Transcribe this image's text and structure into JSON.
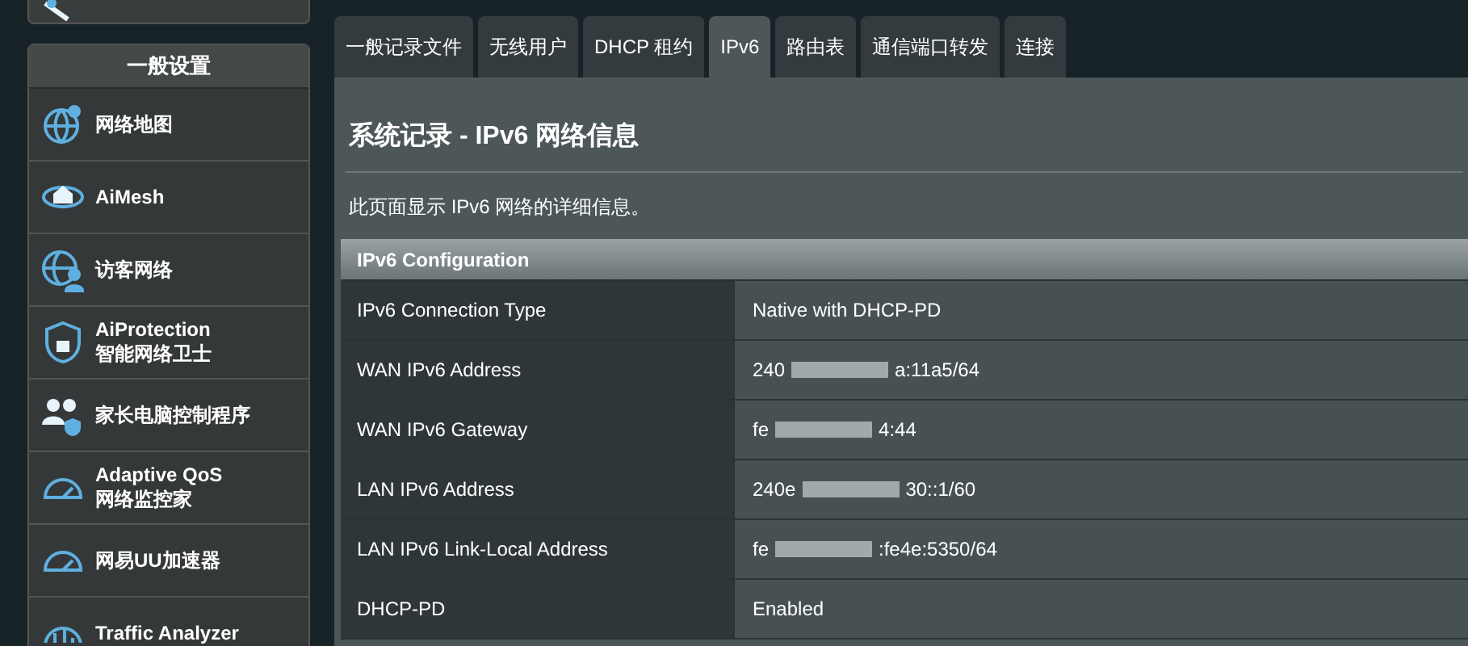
{
  "sidebar": {
    "section_title": "一般设置",
    "items": [
      {
        "title": "网络地图",
        "selected": false
      },
      {
        "title": "AiMesh",
        "selected": false
      },
      {
        "title": "访客网络",
        "selected": false
      },
      {
        "title": "AiProtection",
        "subtitle": "智能网络卫士",
        "selected": false
      },
      {
        "title": "家长电脑控制程序",
        "selected": false
      },
      {
        "title": "Adaptive QoS",
        "subtitle": "网络监控家",
        "selected": false
      },
      {
        "title": "网易UU加速器",
        "selected": false
      },
      {
        "title": "Traffic Analyzer",
        "selected": false
      }
    ]
  },
  "tabs": [
    {
      "label": "一般记录文件",
      "selected": false
    },
    {
      "label": "无线用户",
      "selected": false
    },
    {
      "label": "DHCP 租约",
      "selected": false
    },
    {
      "label": "IPv6",
      "selected": true
    },
    {
      "label": "路由表",
      "selected": false
    },
    {
      "label": "通信端口转发",
      "selected": false
    },
    {
      "label": "连接",
      "selected": false
    }
  ],
  "page": {
    "title": "系统记录 - IPv6 网络信息",
    "description": "此页面显示 IPv6 网络的详细信息。"
  },
  "table": {
    "header": "IPv6 Configuration",
    "rows": [
      {
        "label": "IPv6 Connection Type",
        "value_start": "Native with DHCP-PD"
      },
      {
        "label": "WAN IPv6 Address",
        "value_start": "240",
        "value_end": "a:11a5/64"
      },
      {
        "label": "WAN IPv6 Gateway",
        "value_start": "fe",
        "value_end": "4:44"
      },
      {
        "label": "LAN IPv6 Address",
        "value_start": "240e",
        "value_end": "30::1/60"
      },
      {
        "label": "LAN IPv6 Link-Local Address",
        "value_start": "fe",
        "value_end": ":fe4e:5350/64"
      },
      {
        "label": "DHCP-PD",
        "value_start": "Enabled"
      }
    ]
  }
}
